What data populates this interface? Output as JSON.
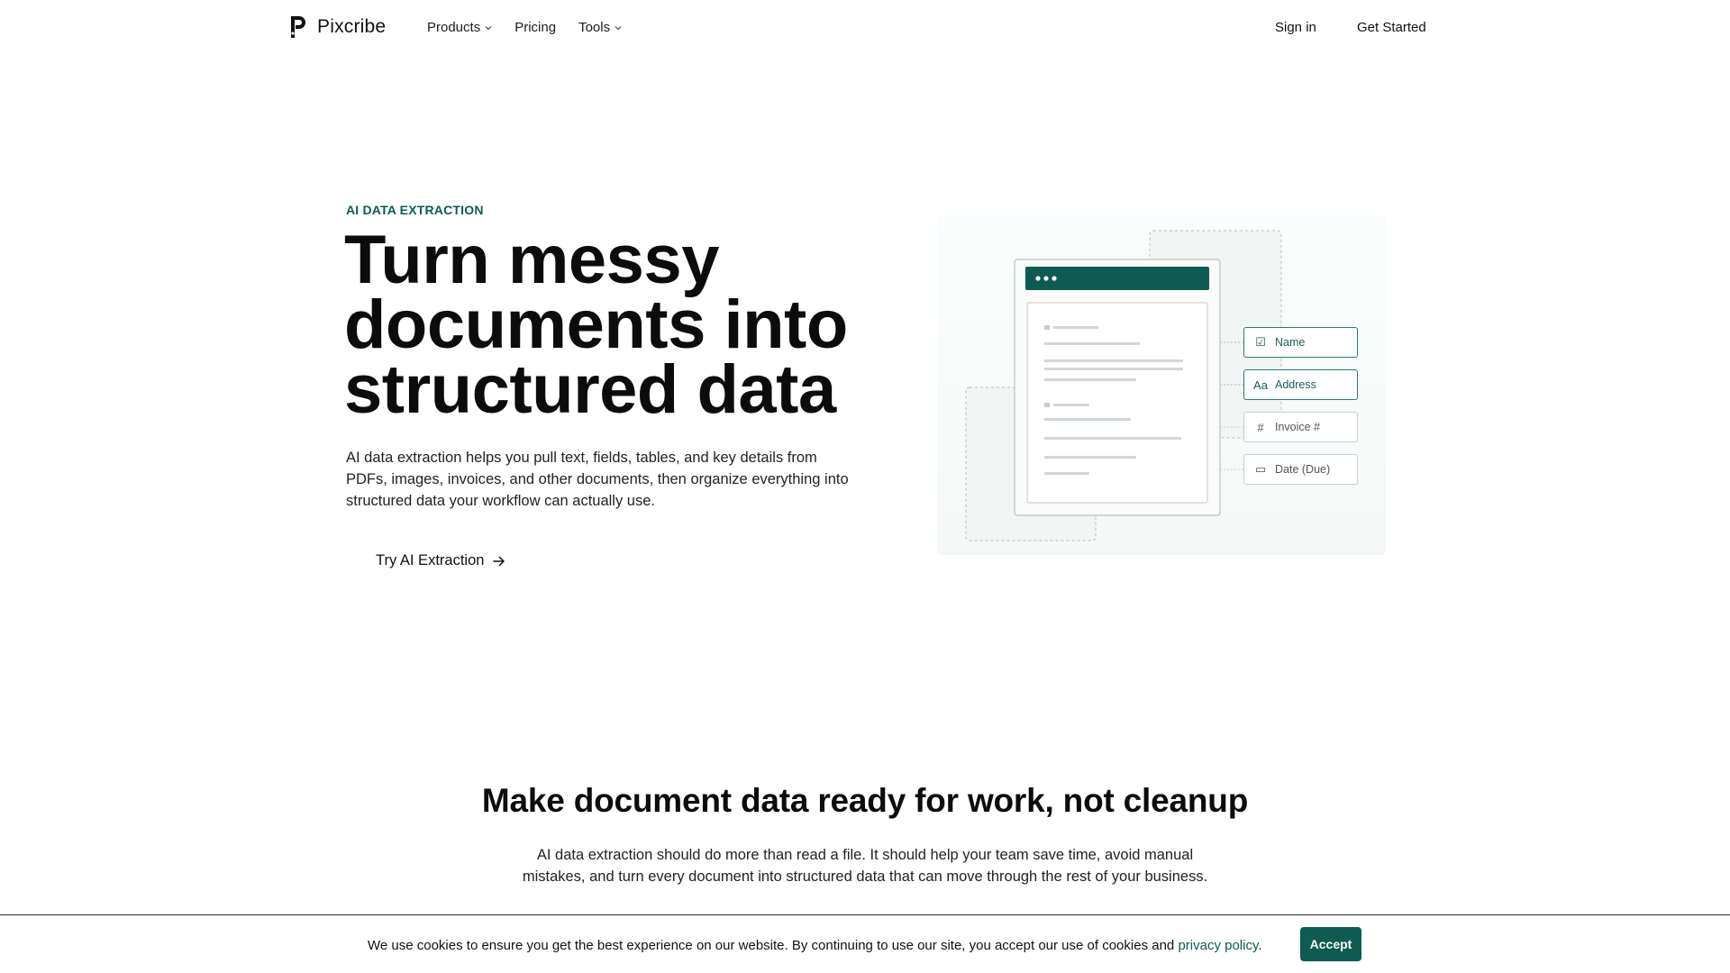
{
  "brand": {
    "name": "Pixcribe",
    "logo_icon": "pixcribe-logo-icon",
    "accent": "#0f5b52"
  },
  "nav": {
    "items": [
      {
        "label": "Products",
        "has_dropdown": true
      },
      {
        "label": "Pricing",
        "has_dropdown": false
      },
      {
        "label": "Tools",
        "has_dropdown": true
      }
    ],
    "sign_in": "Sign in",
    "get_started": "Get Started"
  },
  "hero": {
    "eyebrow": "AI DATA EXTRACTION",
    "title": "Turn messy documents into structured data",
    "description": "AI data extraction helps you pull text, fields, tables, and key details from PDFs, images, invoices, and other documents, then organize everything into structured data your workflow can actually use.",
    "cta": "Try AI Extraction",
    "cta_icon": "arrow-right-icon"
  },
  "illustration": {
    "fields": [
      {
        "icon": "checkbox-icon",
        "glyph": "☑",
        "label": "Name",
        "active": true
      },
      {
        "icon": "text-type-icon",
        "glyph": "Aa",
        "label": "Address",
        "active": true
      },
      {
        "icon": "hash-icon",
        "glyph": "#",
        "label": "Invoice #",
        "active": false
      },
      {
        "icon": "calendar-icon",
        "glyph": "▭",
        "label": "Date (Due)",
        "active": false
      }
    ]
  },
  "section2": {
    "title": "Make document data ready for work, not cleanup",
    "description": "AI data extraction should do more than read a file. It should help your team save time, avoid manual mistakes, and turn every document into structured data that can move through the rest of your business."
  },
  "cookie": {
    "text": "We use cookies to ensure you get the best experience on our website. By continuing to use our site, you accept our use of cookies and ",
    "link": "privacy policy",
    "suffix": ".",
    "accept": "Accept"
  }
}
